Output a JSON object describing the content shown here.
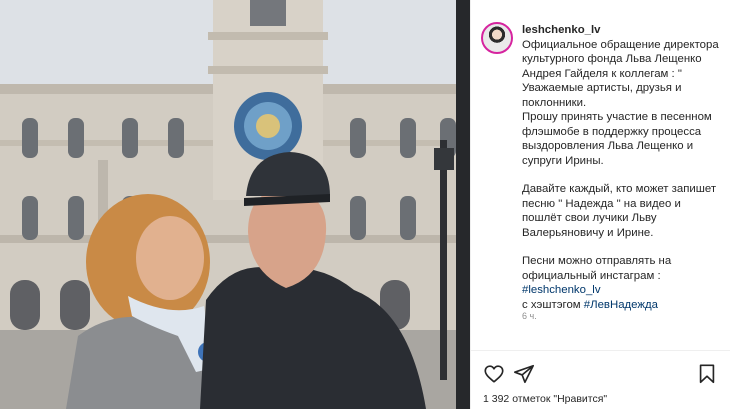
{
  "post": {
    "username": "leshchenko_lv",
    "caption": {
      "paragraph_1": [
        "Официальное обращение директора",
        "культурного фонда Льва  Лещенко",
        "Андрея Гайделя к  коллегам : \"",
        "Уважаемые артисты, друзья и",
        "поклонники."
      ],
      "paragraph_2": [
        "Прошу принять участие в песенном",
        "флэшмобе в поддержку  процесса",
        "выздоровления Льва Лещенко и",
        "супруги Ирины."
      ],
      "paragraph_3": [
        "Давайте каждый, кто может запишет",
        "песню \" Надежда \" на видео  и",
        "пошлёт свои лучики Льву",
        "Валерьяновичу и Ирине."
      ],
      "paragraph_4": [
        "Песни можно отправлять  на",
        "официальный инстаграм :"
      ],
      "mention": "#leshchenko_lv",
      "hashtag_prefix": "с хэштэгом ",
      "hashtag": "#ЛевНадежда"
    },
    "time_ago": "6 ч.",
    "likes_text": "1 392 отметок \"Нравится\""
  },
  "icons": {
    "like": "heart-outline-icon",
    "share": "paper-plane-icon",
    "save": "bookmark-icon"
  },
  "colors": {
    "text": "#262626",
    "link": "#00376b",
    "muted": "#8e8e8e",
    "avatar_ring": "#d6249f"
  }
}
